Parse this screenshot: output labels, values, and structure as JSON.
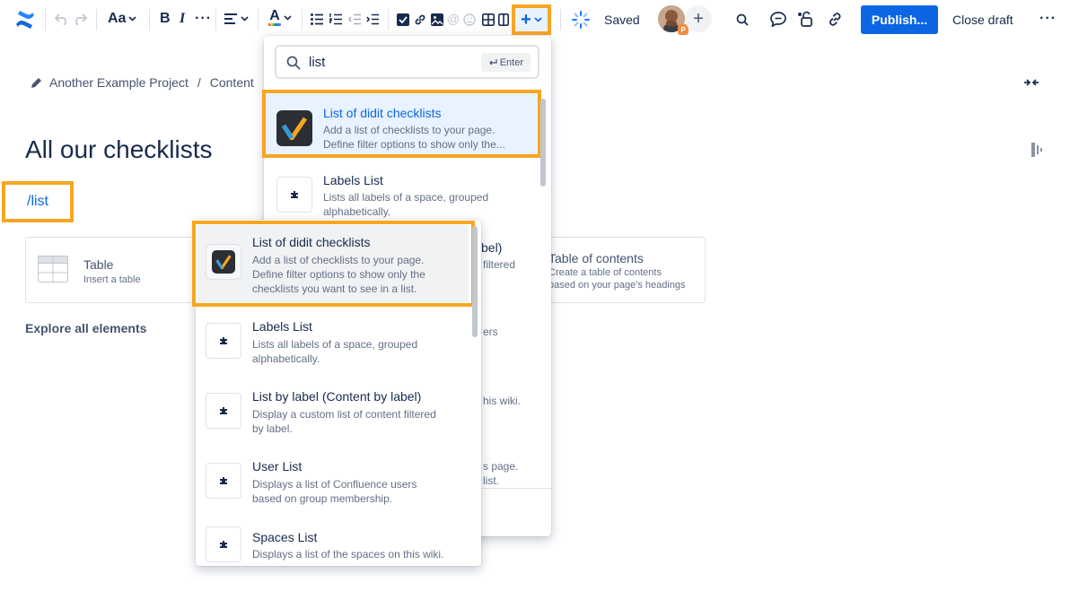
{
  "toolbar": {
    "text_style_label": "Aa",
    "saved_label": "Saved",
    "publish_label": "Publish...",
    "close_draft_label": "Close draft",
    "insert_plus": "+",
    "avatar_badge": "P",
    "accent_color": "#0c66e4",
    "highlight_color": "#f6a623"
  },
  "breadcrumb": {
    "items": [
      "Another Example Project",
      "Content"
    ],
    "separator": "/"
  },
  "page": {
    "title": "All our checklists",
    "slash_command": "/list"
  },
  "cards": {
    "table": {
      "title": "Table",
      "desc": "Insert a table"
    },
    "toc": {
      "title": "Table of contents",
      "desc_lines": [
        "Create a table of contents",
        "based on your page's headings"
      ]
    }
  },
  "explore_label": "Explore all elements",
  "search": {
    "value": "list",
    "enter_hint": "Enter"
  },
  "back_panel": {
    "items": [
      {
        "title": "List of didit checklists",
        "desc_lines": [
          "Add a list of checklists to your page.",
          "Define filter options to show only the..."
        ]
      },
      {
        "title": "Labels List",
        "desc_lines": [
          "Lists all labels of a space, grouped",
          "alphabetically."
        ]
      }
    ],
    "peek_fragments": [
      "bel)",
      "filtered",
      "ers",
      "his wiki.",
      "s page.",
      "list."
    ]
  },
  "front_panel": {
    "items": [
      {
        "title": "List of didit checklists",
        "desc_lines": [
          "Add a list of checklists to your page.",
          "Define filter options to show only the",
          "checklists you want to see in a list."
        ]
      },
      {
        "title": "Labels List",
        "desc_lines": [
          "Lists all labels of a space, grouped",
          "alphabetically."
        ]
      },
      {
        "title": "List by label (Content by label)",
        "desc_lines": [
          "Display a custom list of content filtered",
          "by label."
        ]
      },
      {
        "title": "User List",
        "desc_lines": [
          "Displays a list of Confluence users",
          "based on group membership."
        ]
      },
      {
        "title": "Spaces List",
        "desc_lines": [
          "Displays a list of the spaces on this wiki."
        ]
      }
    ]
  }
}
